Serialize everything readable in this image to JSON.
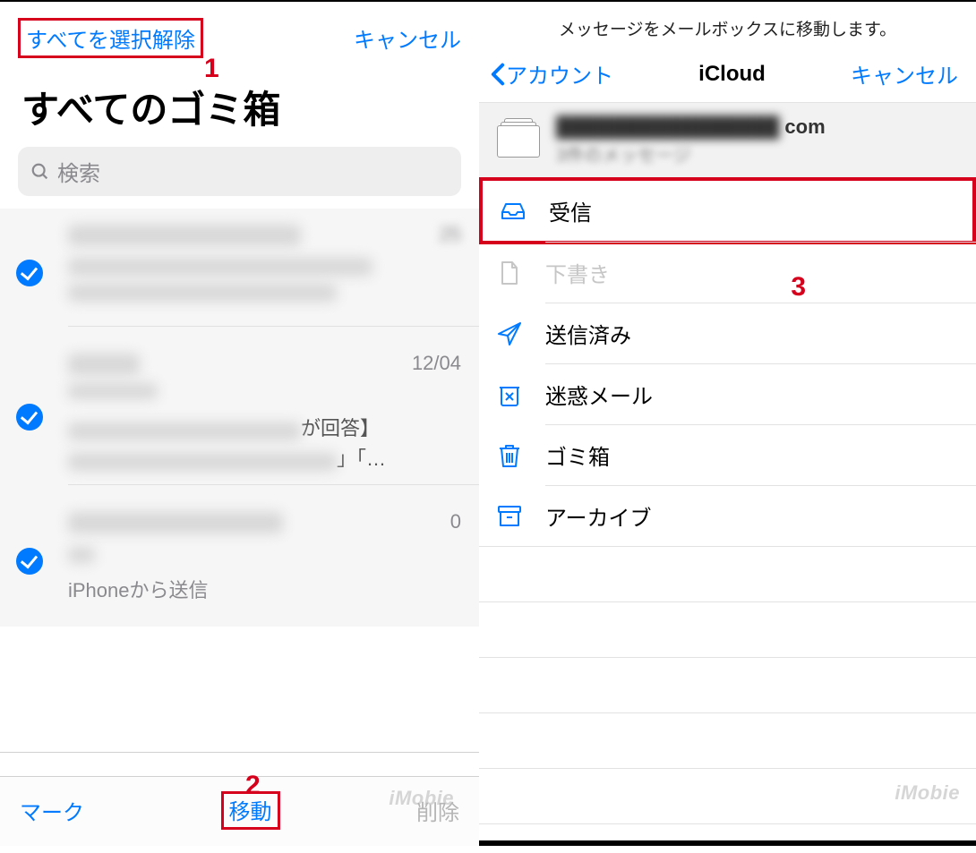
{
  "left": {
    "deselect_all": "すべてを選択解除",
    "cancel": "キャンセル",
    "title": "すべてのゴミ箱",
    "search_placeholder": "検索",
    "messages": [
      {
        "date": "25",
        "date_blurred": true,
        "preview": ""
      },
      {
        "date": "12/04",
        "date_blurred": false,
        "preview_suffix": "が回答】",
        "preview_suffix2": "」「…"
      },
      {
        "date": "0",
        "date_blurred": false,
        "preview": "iPhoneから送信"
      }
    ],
    "toolbar": {
      "mark": "マーク",
      "move": "移動",
      "delete": "削除"
    }
  },
  "right": {
    "toast": "メッセージをメールボックスに移動します。",
    "back": "アカウント",
    "title": "iCloud",
    "cancel": "キャンセル",
    "account_suffix": "com",
    "msg_count": "3件のメッセージ",
    "folders": [
      {
        "key": "inbox",
        "label": "受信",
        "highlighted": true,
        "dim": false
      },
      {
        "key": "drafts",
        "label": "下書き",
        "highlighted": false,
        "dim": true
      },
      {
        "key": "sent",
        "label": "送信済み",
        "highlighted": false,
        "dim": false
      },
      {
        "key": "junk",
        "label": "迷惑メール",
        "highlighted": false,
        "dim": false
      },
      {
        "key": "trash",
        "label": "ゴミ箱",
        "highlighted": false,
        "dim": false
      },
      {
        "key": "archive",
        "label": "アーカイブ",
        "highlighted": false,
        "dim": false
      }
    ]
  },
  "annotations": {
    "n1": "1",
    "n2": "2",
    "n3": "3"
  },
  "watermark": "iMobie"
}
